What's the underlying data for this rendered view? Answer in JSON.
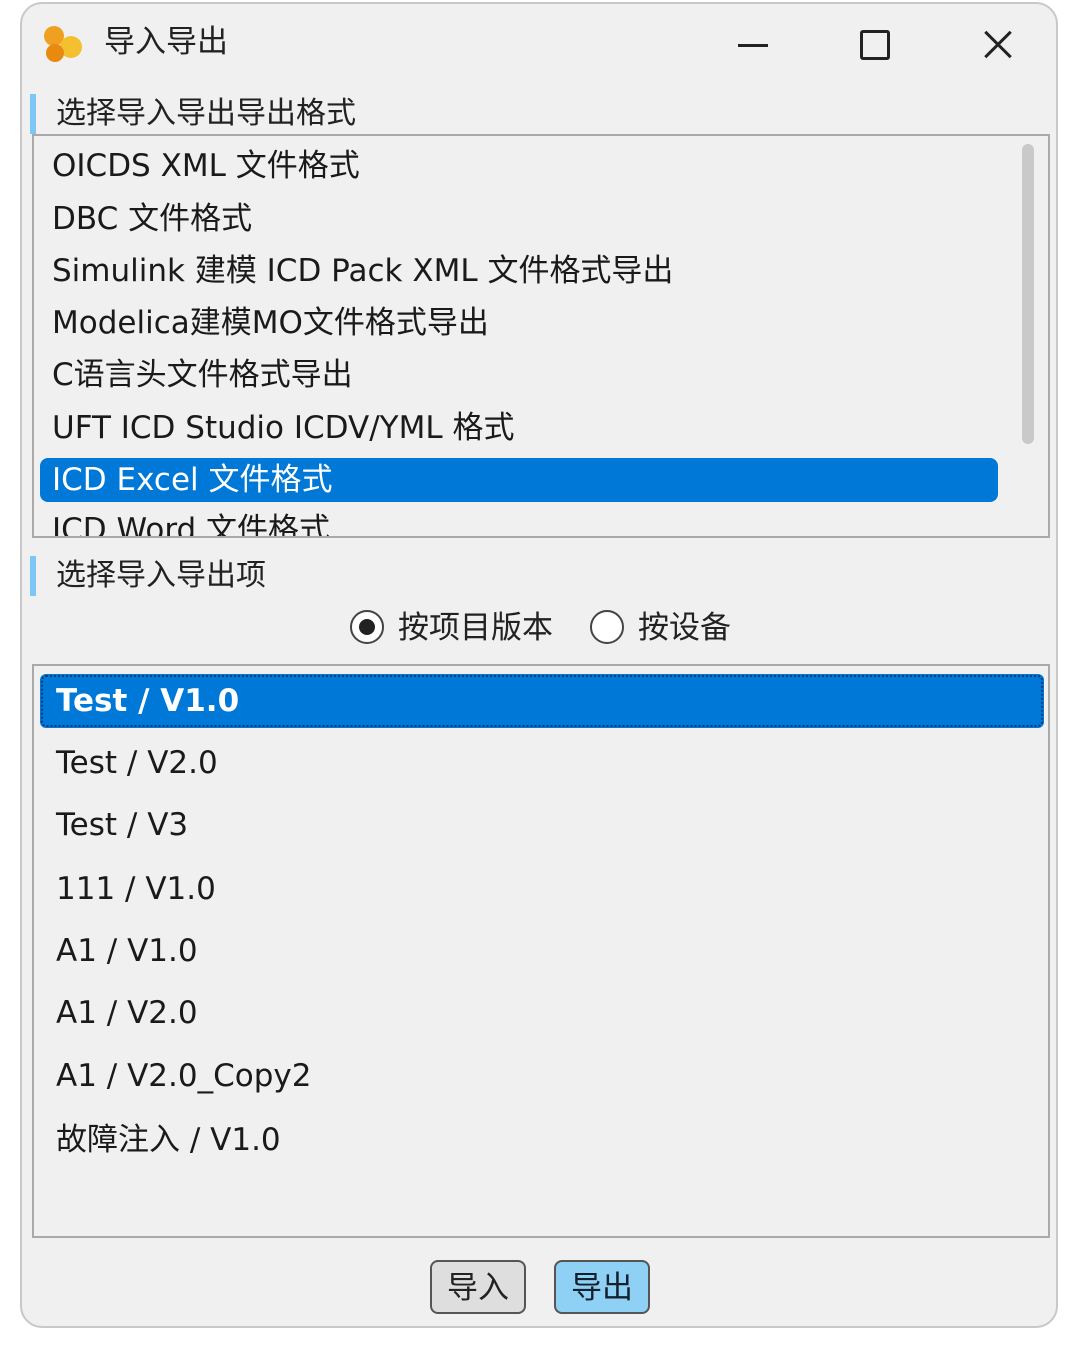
{
  "window": {
    "title": "导入导出",
    "controls": {
      "minimize": "minimize",
      "maximize": "maximize",
      "close": "close"
    },
    "icon": "app-logo-icon",
    "accent_color": "#0078d7",
    "section_marker_color": "#7dc6f5"
  },
  "format_section": {
    "label": "选择导入导出导出格式",
    "items": [
      "OICDS XML 文件格式",
      "DBC 文件格式",
      "Simulink 建模 ICD Pack XML 文件格式导出",
      "Modelica建模MO文件格式导出",
      "C语言头文件格式导出",
      "UFT ICD Studio ICDV/YML 格式",
      "ICD Excel 文件格式",
      "ICD Word 文件格式"
    ],
    "selected_index": 6
  },
  "item_section": {
    "label": "选择导入导出项",
    "radio": [
      {
        "label": "按项目版本",
        "checked": true
      },
      {
        "label": "按设备",
        "checked": false
      }
    ],
    "items": [
      "Test / V1.0",
      "Test / V2.0",
      "Test / V3",
      "111 / V1.0",
      "A1 / V1.0",
      "A1 / V2.0",
      "A1 / V2.0_Copy2",
      "故障注入 / V1.0"
    ],
    "selected_index": 0
  },
  "buttons": {
    "import_label": "导入",
    "export_label": "导出"
  }
}
